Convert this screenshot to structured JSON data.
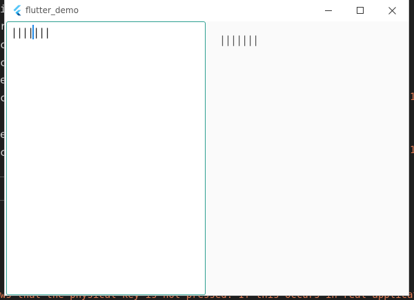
{
  "background": {
    "left_chars": [
      "i",
      "r",
      "c",
      "c",
      "e",
      "c",
      "e",
      "c"
    ],
    "bottom_line": "ws that the physical key is not pressed. If this occurs in real application, p",
    "right_marks": [
      "1",
      "1"
    ]
  },
  "window": {
    "title": "flutter_demo",
    "icon": "flutter-logo-icon",
    "controls": {
      "minimize": "minimize-icon",
      "maximize": "maximize-icon",
      "close": "close-icon"
    }
  },
  "text_field": {
    "value": "|||||||"
  },
  "echo": {
    "text": "|||||||"
  },
  "colors": {
    "field_border": "#2a9d8f",
    "caret": "#1e88e5",
    "window_bg": "#fafafa",
    "terminal_bg": "#1e1e1e",
    "terminal_warning": "#e07b53"
  }
}
